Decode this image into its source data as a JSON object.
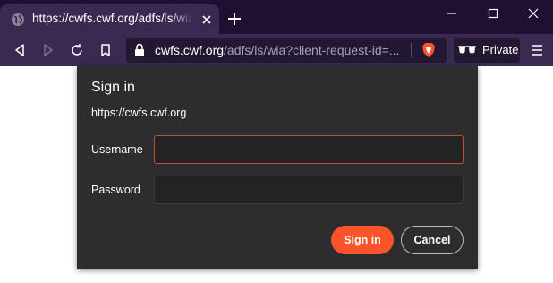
{
  "browser": {
    "tab": {
      "title": "https://cwfs.cwf.org/adfs/ls/wia?client-request-id="
    },
    "address": {
      "host": "cwfs.cwf.org",
      "path": "/adfs/ls/wia?client-request-id=..."
    },
    "private_label": "Private"
  },
  "dialog": {
    "title": "Sign in",
    "origin": "https://cwfs.cwf.org",
    "username_label": "Username",
    "username_value": "",
    "password_label": "Password",
    "password_value": "",
    "signin_label": "Sign in",
    "cancel_label": "Cancel"
  },
  "colors": {
    "accent": "#fb542b",
    "titlebar": "#1f1033",
    "toolbar": "#3a2a52",
    "dialog_bg": "#2d2d30"
  }
}
